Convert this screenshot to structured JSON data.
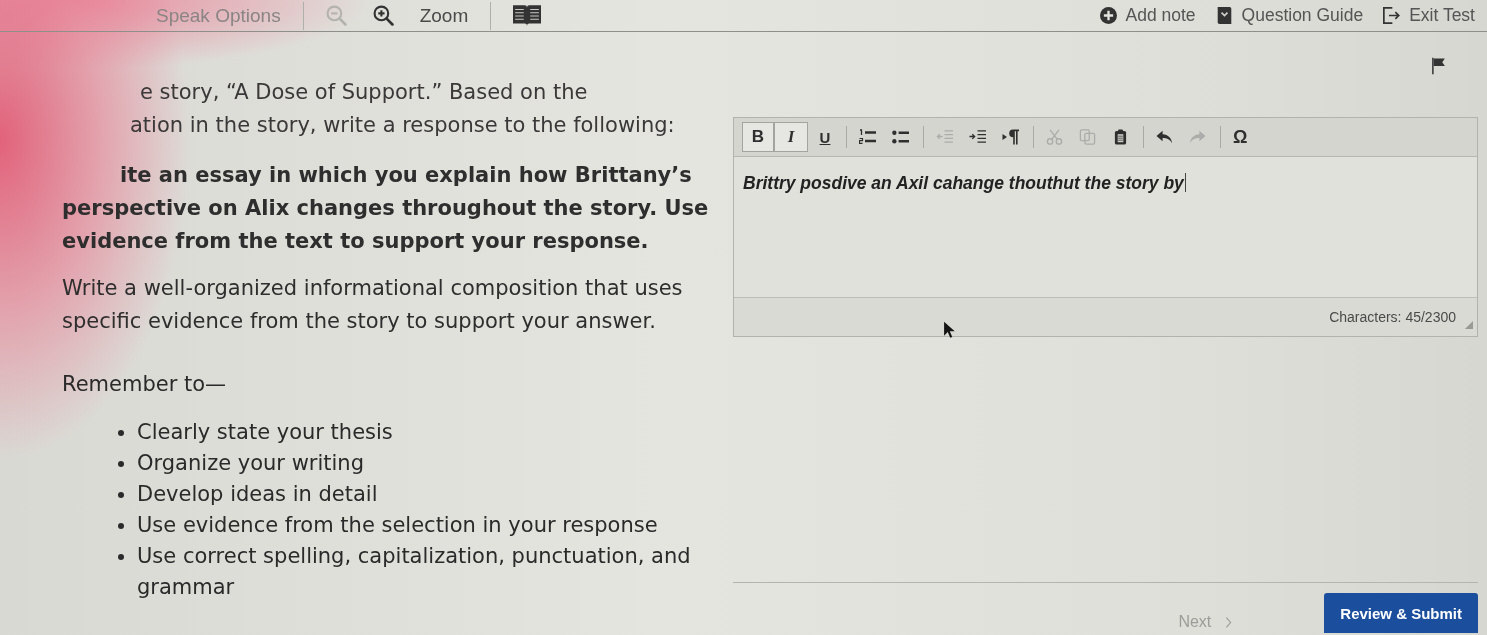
{
  "top_bar": {
    "groups": [
      [
        {
          "kind": "menu",
          "label": "Speak Options",
          "disabled": false
        }
      ],
      [
        {
          "kind": "zoom_out",
          "disabled": true
        },
        {
          "kind": "zoom_in",
          "disabled": false
        },
        {
          "kind": "label",
          "label": "Zoom",
          "disabled": false
        }
      ],
      [
        {
          "kind": "reader",
          "disabled": false
        }
      ]
    ],
    "actions": [
      {
        "kind": "note",
        "label": "Add note"
      },
      {
        "kind": "guide",
        "label": "Question Guide"
      },
      {
        "kind": "exit",
        "label": "Exit Test"
      }
    ]
  },
  "prompt": {
    "paragraphs": [
      {
        "bold": false,
        "lines": [
          "e story, “A Dose of Support.” Based on the",
          "ation in the story, write a response to the following:"
        ]
      },
      {
        "bold": true,
        "lines": [
          "ite an essay in which you explain how Brittany’s",
          "perspective on Alix changes throughout the story. Use",
          "evidence from the text to support your response."
        ]
      },
      {
        "bold": false,
        "lines": [
          "Write a well-organized informational composition that uses",
          "specific evidence from the story to support your answer."
        ]
      }
    ],
    "remember": "Remember to—",
    "checklist": [
      "Clearly state your thesis",
      "Organize your writing",
      "Develop ideas in detail",
      "Use evidence from the selection in your response",
      "Use correct spelling, capitalization, punctuation, and grammar"
    ]
  },
  "editor": {
    "toolbar": [
      [
        {
          "kind": "bold",
          "label": "B",
          "active": true,
          "disabled": false
        },
        {
          "kind": "italic",
          "label": "I",
          "active": true,
          "disabled": false
        },
        {
          "kind": "underline",
          "label": "U",
          "active": false,
          "disabled": false
        }
      ],
      [
        {
          "kind": "ordered_list",
          "active": false,
          "disabled": false
        },
        {
          "kind": "bullet_list",
          "active": false,
          "disabled": false
        }
      ],
      [
        {
          "kind": "outdent",
          "active": false,
          "disabled": true
        },
        {
          "kind": "indent",
          "active": false,
          "disabled": false
        },
        {
          "kind": "ltr",
          "active": false,
          "disabled": false
        }
      ],
      [
        {
          "kind": "cut",
          "active": false,
          "disabled": true
        },
        {
          "kind": "copy",
          "active": false,
          "disabled": true
        },
        {
          "kind": "paste",
          "active": false,
          "disabled": false
        }
      ],
      [
        {
          "kind": "undo",
          "active": false,
          "disabled": false
        },
        {
          "kind": "redo",
          "active": false,
          "disabled": true
        }
      ],
      [
        {
          "kind": "special",
          "label": "Ω",
          "active": false,
          "disabled": false
        }
      ]
    ],
    "text": "Brittry posdive an Axil cahange thouthut the story by",
    "character_count": "Characters: 45/2300"
  },
  "navigation": {
    "next": {
      "label": "Next",
      "disabled": true
    },
    "submit": {
      "label": "Review & Submit"
    }
  }
}
